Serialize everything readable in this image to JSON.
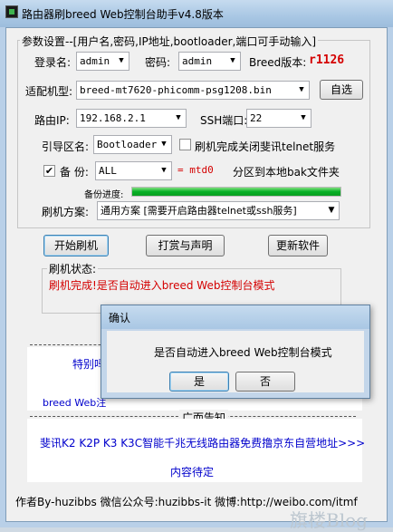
{
  "window": {
    "title": "路由器刷breed Web控制台助手v4.8版本"
  },
  "params": {
    "group_label": "参数设置--[用户名,密码,IP地址,bootloader,端口可手动输入]",
    "login_label": "登录名:",
    "login_value": "admin",
    "password_label": "密码:",
    "password_value": "admin",
    "breed_version_label": "Breed版本:",
    "breed_version_value": "r1126",
    "model_label": "适配机型:",
    "model_value": "breed-mt7620-phicomm-psg1208.bin",
    "select_button": "自选",
    "router_ip_label": "路由IP:",
    "router_ip_value": "192.168.2.1",
    "ssh_port_label": "SSH端口:",
    "ssh_port_value": "22",
    "boot_label": "引导区名:",
    "boot_value": "Bootloader",
    "telnet_close_label": "刷机完成关闭斐讯telnet服务",
    "backup_label": "备 份:",
    "backup_value": "ALL",
    "backup_mapping": "= mtd0",
    "backup_desc": "分区到本地bak文件夹",
    "progress_label": "备份进度:",
    "progress_value": 1.0,
    "scheme_label": "刷机方案:",
    "scheme_value": "通用方案 [需要开启路由器telnet或ssh服务]"
  },
  "actions": {
    "start": "开始刷机",
    "donate": "打赏与声明",
    "update": "更新软件"
  },
  "status": {
    "label": "刷机状态:",
    "message": "刷机完成!是否自动进入breed Web控制台模式"
  },
  "partial": {
    "line1": "特别吗",
    "line2": "breed Web注"
  },
  "ads": {
    "header": "广而告知",
    "line1": "斐讯K2 K2P K3 K3C智能千兆无线路由器免费撸京东自营地址>>>",
    "line2": "内容待定"
  },
  "footer": {
    "text": "作者By-huzibbs 微信公众号:huzibbs-it 微博:http://weibo.com/itmfb"
  },
  "dialog": {
    "title": "确认",
    "message": "是否自动进入breed Web控制台模式",
    "yes": "是",
    "no": "否"
  },
  "watermark": "旗楼Blog",
  "colors": {
    "accent_red": "#d40000",
    "link_blue": "#0000cc",
    "progress_green": "#06b025"
  }
}
